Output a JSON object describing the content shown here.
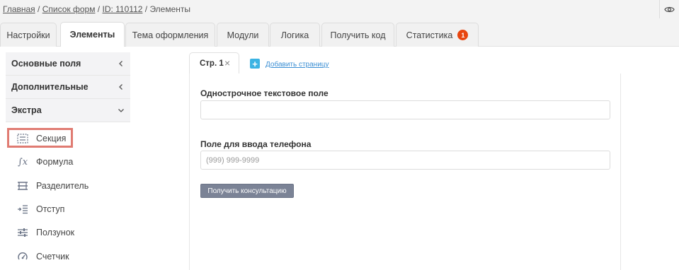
{
  "breadcrumb": {
    "home": "Главная",
    "sep1": "/",
    "forms": "Список форм",
    "sep2": "/",
    "form_id": "ID: 110112",
    "sep3": "/",
    "current": "Элементы"
  },
  "tabs": [
    {
      "label": "Настройки"
    },
    {
      "label": "Элементы"
    },
    {
      "label": "Тема оформления"
    },
    {
      "label": "Модули"
    },
    {
      "label": "Логика"
    },
    {
      "label": "Получить код"
    },
    {
      "label": "Статистика",
      "badge": "1"
    }
  ],
  "sidebar": {
    "groups": [
      {
        "label": "Основные поля",
        "state": "collapsed"
      },
      {
        "label": "Дополнительные",
        "state": "collapsed"
      },
      {
        "label": "Экстра",
        "state": "expanded"
      }
    ],
    "items": [
      {
        "label": "Секция",
        "icon": "section-icon"
      },
      {
        "label": "Формула",
        "icon": "formula-icon"
      },
      {
        "label": "Разделитель",
        "icon": "divider-icon"
      },
      {
        "label": "Отступ",
        "icon": "indent-icon"
      },
      {
        "label": "Ползунок",
        "icon": "slider-icon"
      },
      {
        "label": "Счетчик",
        "icon": "counter-icon"
      }
    ]
  },
  "pages": {
    "tab_label": "Стр. 1",
    "add_page_label": "Добавить страницу"
  },
  "form": {
    "field1_label": "Однострочное текстовое поле",
    "field1_value": "",
    "field2_label": "Поле для ввода телефона",
    "field2_placeholder": "(999) 999-9999",
    "submit_label": "Получить консультацию"
  },
  "colors": {
    "badge": "#e8450f",
    "accent": "#3bb3e3",
    "highlight": "#e07b72",
    "button": "#7b8396"
  }
}
